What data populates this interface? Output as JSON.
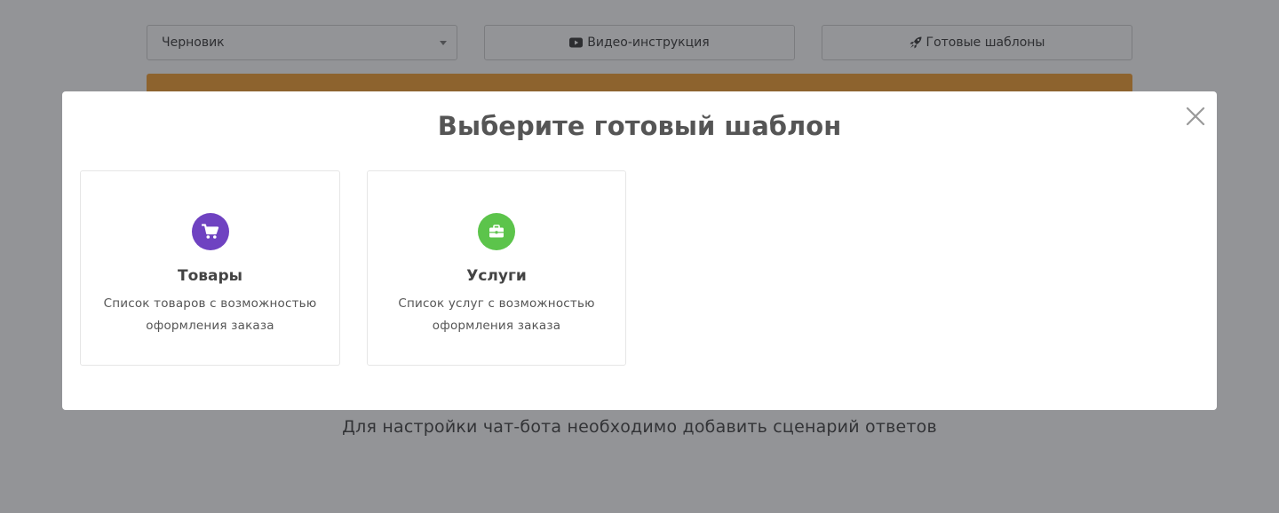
{
  "toolbar": {
    "status_value": "Черновик",
    "video_label": "Видео-инструкция",
    "templates_label": "Готовые шаблоны"
  },
  "page": {
    "empty_message": "Для настройки чат-бота необходимо добавить сценарий ответов"
  },
  "modal": {
    "title": "Выберите готовый шаблон",
    "cards": [
      {
        "title": "Товары",
        "description": "Список товаров с возможностью оформления заказа",
        "icon": "shopping-cart-icon",
        "color": "#6f42c1"
      },
      {
        "title": "Услуги",
        "description": "Список услуг с возможностью оформления заказа",
        "icon": "briefcase-icon",
        "color": "#5cc44b"
      }
    ]
  },
  "colors": {
    "accent_orange": "#f39c2c",
    "overlay": "rgba(40,42,48,0.5)"
  }
}
